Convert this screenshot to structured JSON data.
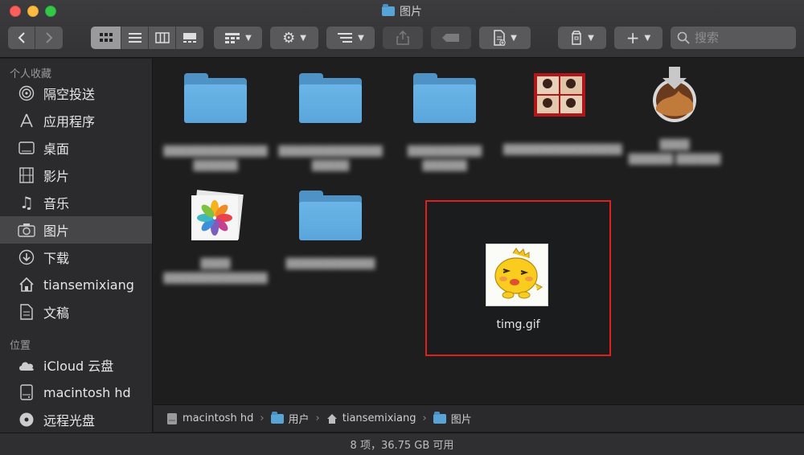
{
  "window": {
    "title": "图片"
  },
  "toolbar": {
    "back_icon": "chevron-left-icon",
    "forward_icon": "chevron-right-icon",
    "view_modes": [
      "icon-view-icon",
      "list-view-icon",
      "column-view-icon",
      "gallery-view-icon"
    ],
    "search_placeholder": "搜索"
  },
  "sidebar": {
    "favorites_title": "个人收藏",
    "favorites": [
      {
        "label": "隔空投送",
        "icon": "airdrop-icon"
      },
      {
        "label": "应用程序",
        "icon": "applications-icon"
      },
      {
        "label": "桌面",
        "icon": "desktop-icon"
      },
      {
        "label": "影片",
        "icon": "movies-icon"
      },
      {
        "label": "音乐",
        "icon": "music-icon"
      },
      {
        "label": "图片",
        "icon": "pictures-icon"
      },
      {
        "label": "下载",
        "icon": "downloads-icon"
      },
      {
        "label": "tiansemixiang",
        "icon": "home-icon"
      },
      {
        "label": "文稿",
        "icon": "documents-icon"
      }
    ],
    "locations_title": "位置",
    "locations": [
      {
        "label": "iCloud 云盘",
        "icon": "cloud-icon"
      },
      {
        "label": "macintosh hd",
        "icon": "hard-drive-icon"
      },
      {
        "label": "远程光盘",
        "icon": "disc-icon"
      }
    ]
  },
  "content": {
    "selected_file": {
      "name": "timg.gif"
    }
  },
  "pathbar": {
    "crumbs": [
      "macintosh hd",
      "用户",
      "tiansemixiang",
      "图片"
    ]
  },
  "status": {
    "text": "8 项，36.75 GB 可用"
  },
  "colors": {
    "selection_border": "#e0201c",
    "folder_blue": "#5aa6dc"
  }
}
